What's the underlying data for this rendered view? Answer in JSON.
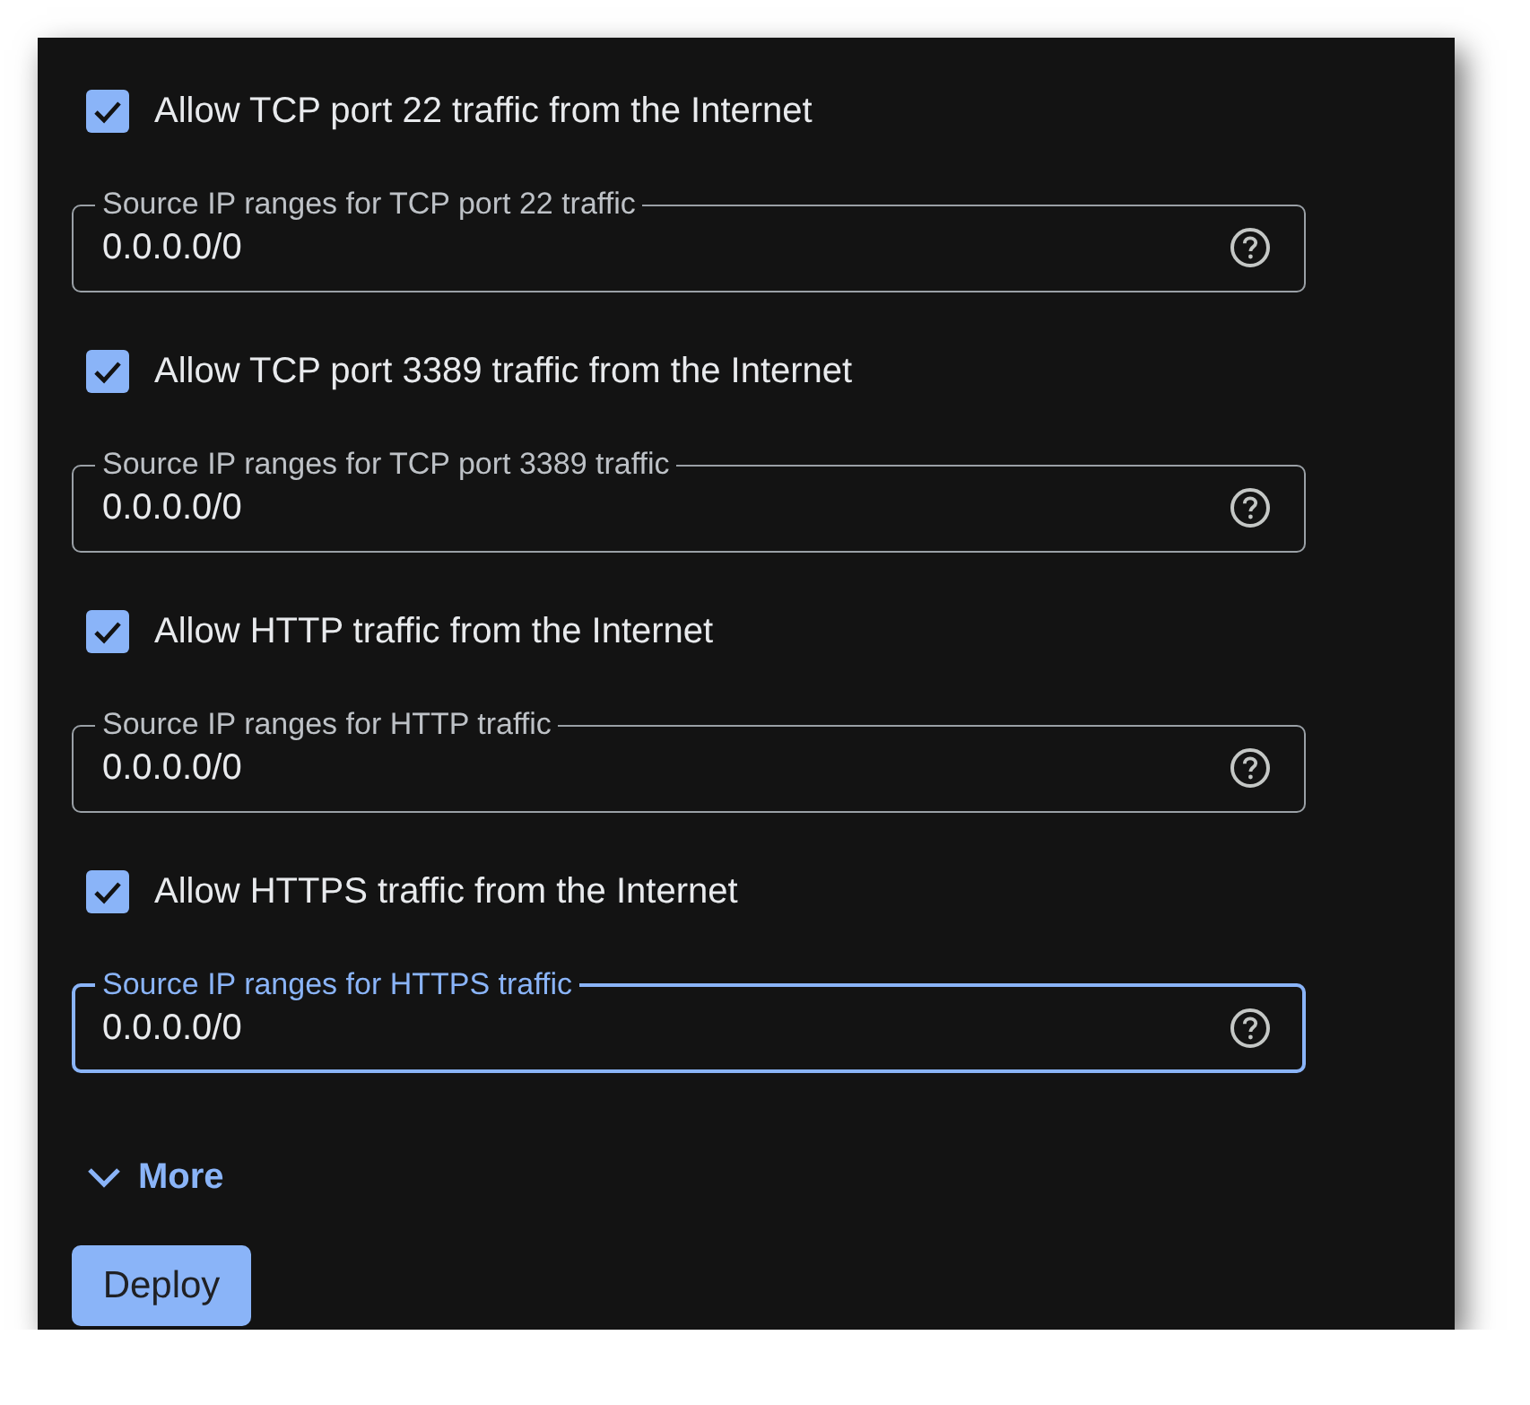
{
  "sections": [
    {
      "checkbox": {
        "label": "Allow TCP port 22 traffic from the Internet",
        "checked": true
      },
      "field": {
        "label": "Source IP ranges for TCP port 22 traffic",
        "value": "0.0.0.0/0",
        "focused": false
      }
    },
    {
      "checkbox": {
        "label": "Allow TCP port 3389 traffic from the Internet",
        "checked": true
      },
      "field": {
        "label": "Source IP ranges for TCP port 3389 traffic",
        "value": "0.0.0.0/0",
        "focused": false
      }
    },
    {
      "checkbox": {
        "label": "Allow HTTP traffic from the Internet",
        "checked": true
      },
      "field": {
        "label": "Source IP ranges for HTTP traffic",
        "value": "0.0.0.0/0",
        "focused": false
      }
    },
    {
      "checkbox": {
        "label": "Allow HTTPS traffic from the Internet",
        "checked": true
      },
      "field": {
        "label": "Source IP ranges for HTTPS traffic",
        "value": "0.0.0.0/0",
        "focused": true
      }
    }
  ],
  "more_link": {
    "label": "More"
  },
  "deploy_button": {
    "label": "Deploy"
  }
}
